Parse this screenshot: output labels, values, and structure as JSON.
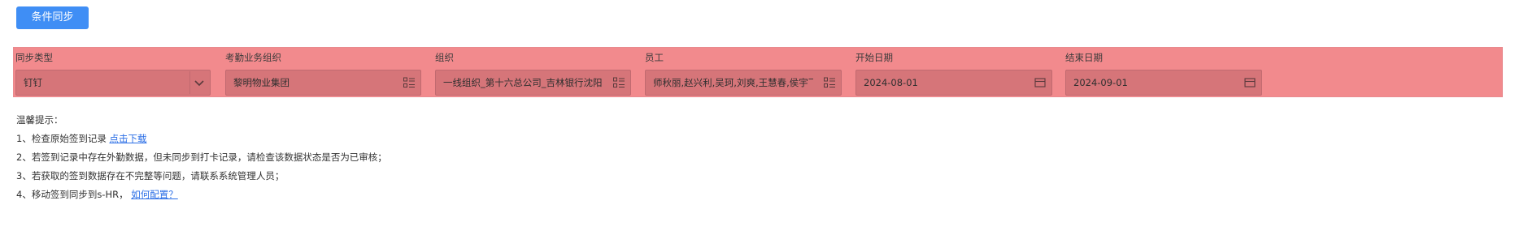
{
  "toolbar": {
    "sync_button_label": "条件同步"
  },
  "filters": {
    "sync_type": {
      "label": "同步类型",
      "value": "钉钉"
    },
    "attendance_org": {
      "label": "考勤业务组织",
      "value": "黎明物业集团"
    },
    "organization": {
      "label": "组织",
      "value": "一线组织_第十六总公司_吉林银行沈阳分行"
    },
    "employees": {
      "label": "员工",
      "value": "师秋丽,赵兴利,吴珂,刘爽,王慧春,侯宇飞,黄杰,孪"
    },
    "start_date": {
      "label": "开始日期",
      "value": "2024-08-01"
    },
    "end_date": {
      "label": "结束日期",
      "value": "2024-09-01"
    }
  },
  "tips": {
    "title": "温馨提示：",
    "line1_text": "1、检查原始签到记录 ",
    "line1_link": "点击下载",
    "line2_text": "2、若签到记录中存在外勤数据，但未同步到打卡记录，请检查该数据状态是否为已审核；",
    "line3_text": "3、若获取的签到数据存在不完整等问题，请联系系统管理人员；",
    "line4_text": "4、移动签到同步到s-HR， ",
    "line4_link": "如何配置？"
  },
  "colors": {
    "primary_button": "#3f8ef5",
    "filter_band": "#f28a8d",
    "field_fill": "#d67579",
    "link": "#2a6ee6"
  },
  "icons": {
    "sync_type": "chevron-down-icon",
    "attendance_org": "list-picker-icon",
    "organization": "list-picker-icon",
    "employees": "list-picker-icon",
    "start_date": "calendar-icon",
    "end_date": "calendar-icon"
  }
}
